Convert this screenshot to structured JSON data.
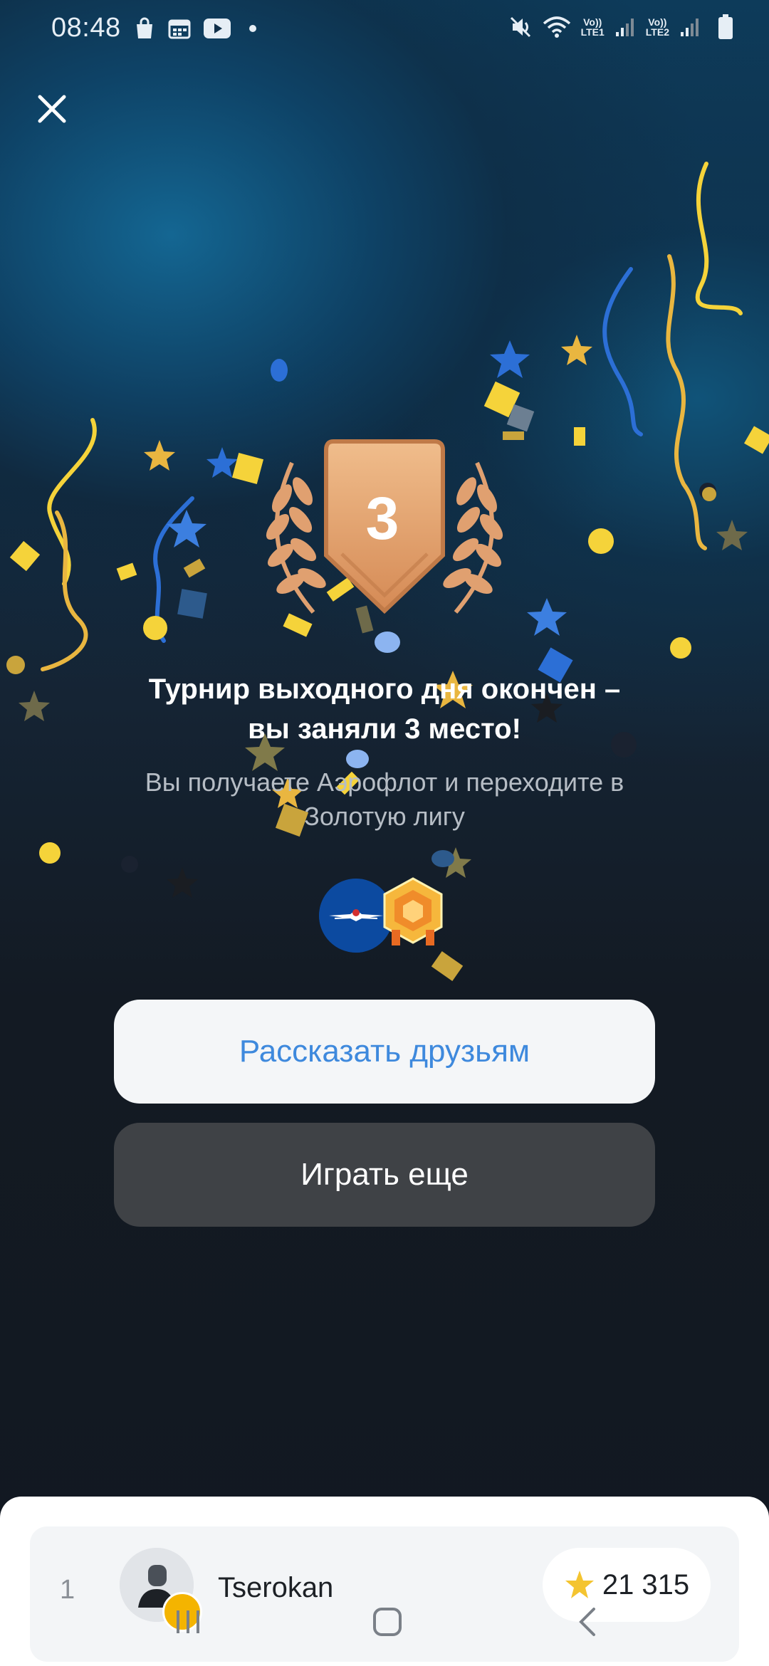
{
  "status_bar": {
    "time": "08:48",
    "left_icons": [
      "bag-icon",
      "calendar-icon",
      "youtube-icon",
      "dot-icon"
    ],
    "right_icons": [
      "mute-icon",
      "wifi-icon",
      "signal-1-icon",
      "signal-2-icon",
      "battery-icon"
    ],
    "sim1": {
      "top": "Vo))",
      "bottom": "LTE1"
    },
    "sim2": {
      "top": "Vo))",
      "bottom": "LTE2"
    }
  },
  "result": {
    "place_number": "3",
    "title_line1": "Турнир выходного дня окончен –",
    "title_line2": "вы заняли 3 место!",
    "subtitle_line1": "Вы получаете Аэрофлот и переходите в",
    "subtitle_line2": "Золотую лигу"
  },
  "buttons": {
    "share": "Рассказать друзьям",
    "play_again": "Играть еще"
  },
  "leaderboard": {
    "rows": [
      {
        "rank": "1",
        "name": "Tserokan",
        "score": "21 315"
      }
    ]
  },
  "colors": {
    "accent_blue": "#3e89dd",
    "bronze": "#e0a070",
    "gold": "#f4c430",
    "background": "#121821"
  }
}
